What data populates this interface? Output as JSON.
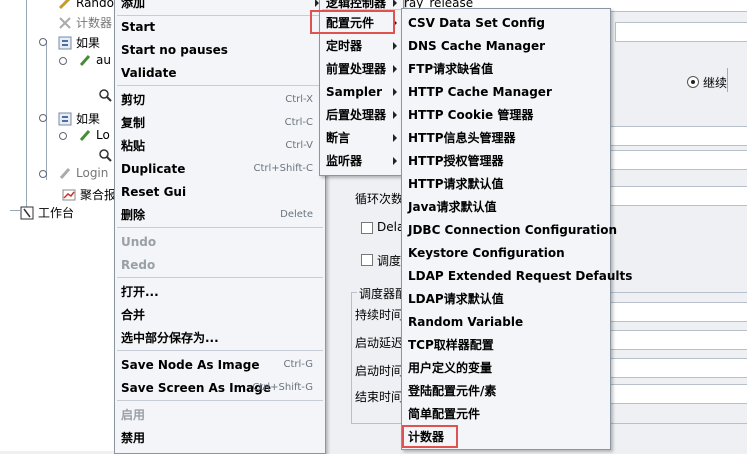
{
  "tree": {
    "nodes": [
      {
        "label": "Rando",
        "gray": false
      },
      {
        "label": "计数器",
        "gray": true
      },
      {
        "label": "如果",
        "gray": false
      },
      {
        "label": "au",
        "gray": false
      },
      {
        "label": "如果",
        "gray": false
      },
      {
        "label": "Lo",
        "gray": false
      },
      {
        "label": "Login",
        "gray": true
      },
      {
        "label": "聚合报",
        "gray": false
      },
      {
        "label": "工作台",
        "gray": false
      }
    ]
  },
  "panel": {
    "name_value": "ray_release",
    "radio_label": "继续",
    "loop_label": "循环次数",
    "delay_label": "Dela",
    "scheduler_label": "调度",
    "scheduler_group_title": "调度器配",
    "duration_label": "持续时间",
    "startup_delay_label": "启动延迟",
    "start_time_label": "启动时间",
    "end_time_label": "结束时间"
  },
  "context_menu": {
    "top_label": "添加",
    "items": [
      {
        "label": "Start",
        "shortcut": "",
        "bold": true,
        "disabled": false
      },
      {
        "label": "Start no pauses",
        "shortcut": "",
        "bold": true,
        "disabled": false
      },
      {
        "label": "Validate",
        "shortcut": "",
        "bold": true,
        "disabled": false
      },
      {
        "label": "剪切",
        "shortcut": "Ctrl-X",
        "bold": true,
        "disabled": false
      },
      {
        "label": "复制",
        "shortcut": "Ctrl-C",
        "bold": true,
        "disabled": false
      },
      {
        "label": "粘贴",
        "shortcut": "Ctrl-V",
        "bold": true,
        "disabled": false
      },
      {
        "label": "Duplicate",
        "shortcut": "Ctrl+Shift-C",
        "bold": true,
        "disabled": false
      },
      {
        "label": "Reset Gui",
        "shortcut": "",
        "bold": true,
        "disabled": false
      },
      {
        "label": "删除",
        "shortcut": "Delete",
        "bold": true,
        "disabled": false
      },
      {
        "label": "Undo",
        "shortcut": "",
        "bold": true,
        "disabled": true
      },
      {
        "label": "Redo",
        "shortcut": "",
        "bold": true,
        "disabled": true
      },
      {
        "label": "打开...",
        "shortcut": "",
        "bold": true,
        "disabled": false
      },
      {
        "label": "合并",
        "shortcut": "",
        "bold": true,
        "disabled": false
      },
      {
        "label": "选中部分保存为...",
        "shortcut": "",
        "bold": true,
        "disabled": false
      },
      {
        "label": "Save Node As Image",
        "shortcut": "Ctrl-G",
        "bold": true,
        "disabled": false
      },
      {
        "label": "Save Screen As Image",
        "shortcut": "Ctrl+Shift-G",
        "bold": true,
        "disabled": false
      },
      {
        "label": "启用",
        "shortcut": "",
        "bold": true,
        "disabled": true
      },
      {
        "label": "禁用",
        "shortcut": "",
        "bold": true,
        "disabled": false
      }
    ]
  },
  "add_submenu": {
    "top_label": "逻辑控制器",
    "items": [
      {
        "label": "配置元件",
        "highlighted": true
      },
      {
        "label": "定时器",
        "highlighted": false
      },
      {
        "label": "前置处理器",
        "highlighted": false
      },
      {
        "label": "Sampler",
        "highlighted": false
      },
      {
        "label": "后置处理器",
        "highlighted": false
      },
      {
        "label": "断言",
        "highlighted": false
      },
      {
        "label": "监听器",
        "highlighted": false
      }
    ]
  },
  "config_submenu": {
    "items": [
      {
        "label": "CSV Data Set Config",
        "highlighted": false
      },
      {
        "label": "DNS Cache Manager",
        "highlighted": false
      },
      {
        "label": "FTP请求缺省值",
        "highlighted": false
      },
      {
        "label": "HTTP Cache Manager",
        "highlighted": false
      },
      {
        "label": "HTTP Cookie 管理器",
        "highlighted": false
      },
      {
        "label": "HTTP信息头管理器",
        "highlighted": false
      },
      {
        "label": "HTTP授权管理器",
        "highlighted": false
      },
      {
        "label": "HTTP请求默认值",
        "highlighted": false
      },
      {
        "label": "Java请求默认值",
        "highlighted": false
      },
      {
        "label": "JDBC Connection Configuration",
        "highlighted": false
      },
      {
        "label": "Keystore Configuration",
        "highlighted": false
      },
      {
        "label": "LDAP Extended Request Defaults",
        "highlighted": false
      },
      {
        "label": "LDAP请求默认值",
        "highlighted": false
      },
      {
        "label": "Random Variable",
        "highlighted": false
      },
      {
        "label": "TCP取样器配置",
        "highlighted": false
      },
      {
        "label": "用户定义的变量",
        "highlighted": false
      },
      {
        "label": "登陆配置元件/素",
        "highlighted": false
      },
      {
        "label": "简单配置元件",
        "highlighted": false
      },
      {
        "label": "计数器",
        "highlighted": true
      }
    ]
  },
  "colors": {
    "highlight_box": "#e0524e",
    "menu_bg": "#f3f5f8",
    "disabled_text": "#9aa0a8"
  }
}
